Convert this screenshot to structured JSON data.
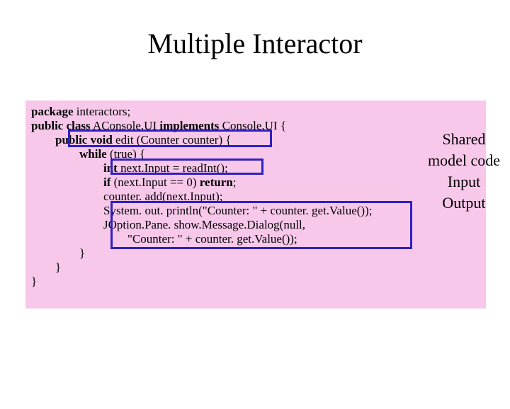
{
  "title": "Multiple Interactor",
  "code": {
    "l1a": "package",
    "l1b": " interactors;",
    "l2a": "public class",
    "l2b": " AConsole.UI ",
    "l2c": "implements",
    "l2d": " Console.UI {",
    "l3a": "public void",
    "l3b": " edit (Counter counter) {",
    "l4a": "while",
    "l4b": " (true) {",
    "l5a": "int",
    "l5b": " next.Input = readInt();",
    "l6a": "if",
    "l6b": " (next.Input == 0) ",
    "l6c": "return",
    "l6d": ";",
    "l7": "counter. add(next.Input);",
    "l8": "System. out. println(\"Counter: \" + counter. get.Value());",
    "l9": "JOption.Pane. show.Message.Dialog(null,",
    "l10": "\"Counter: \" + counter. get.Value());",
    "l11": "}",
    "l12": "}",
    "l13": "}"
  },
  "labels": {
    "shared1": "Shared",
    "shared2": "model code",
    "input": "Input",
    "output": "Output"
  }
}
